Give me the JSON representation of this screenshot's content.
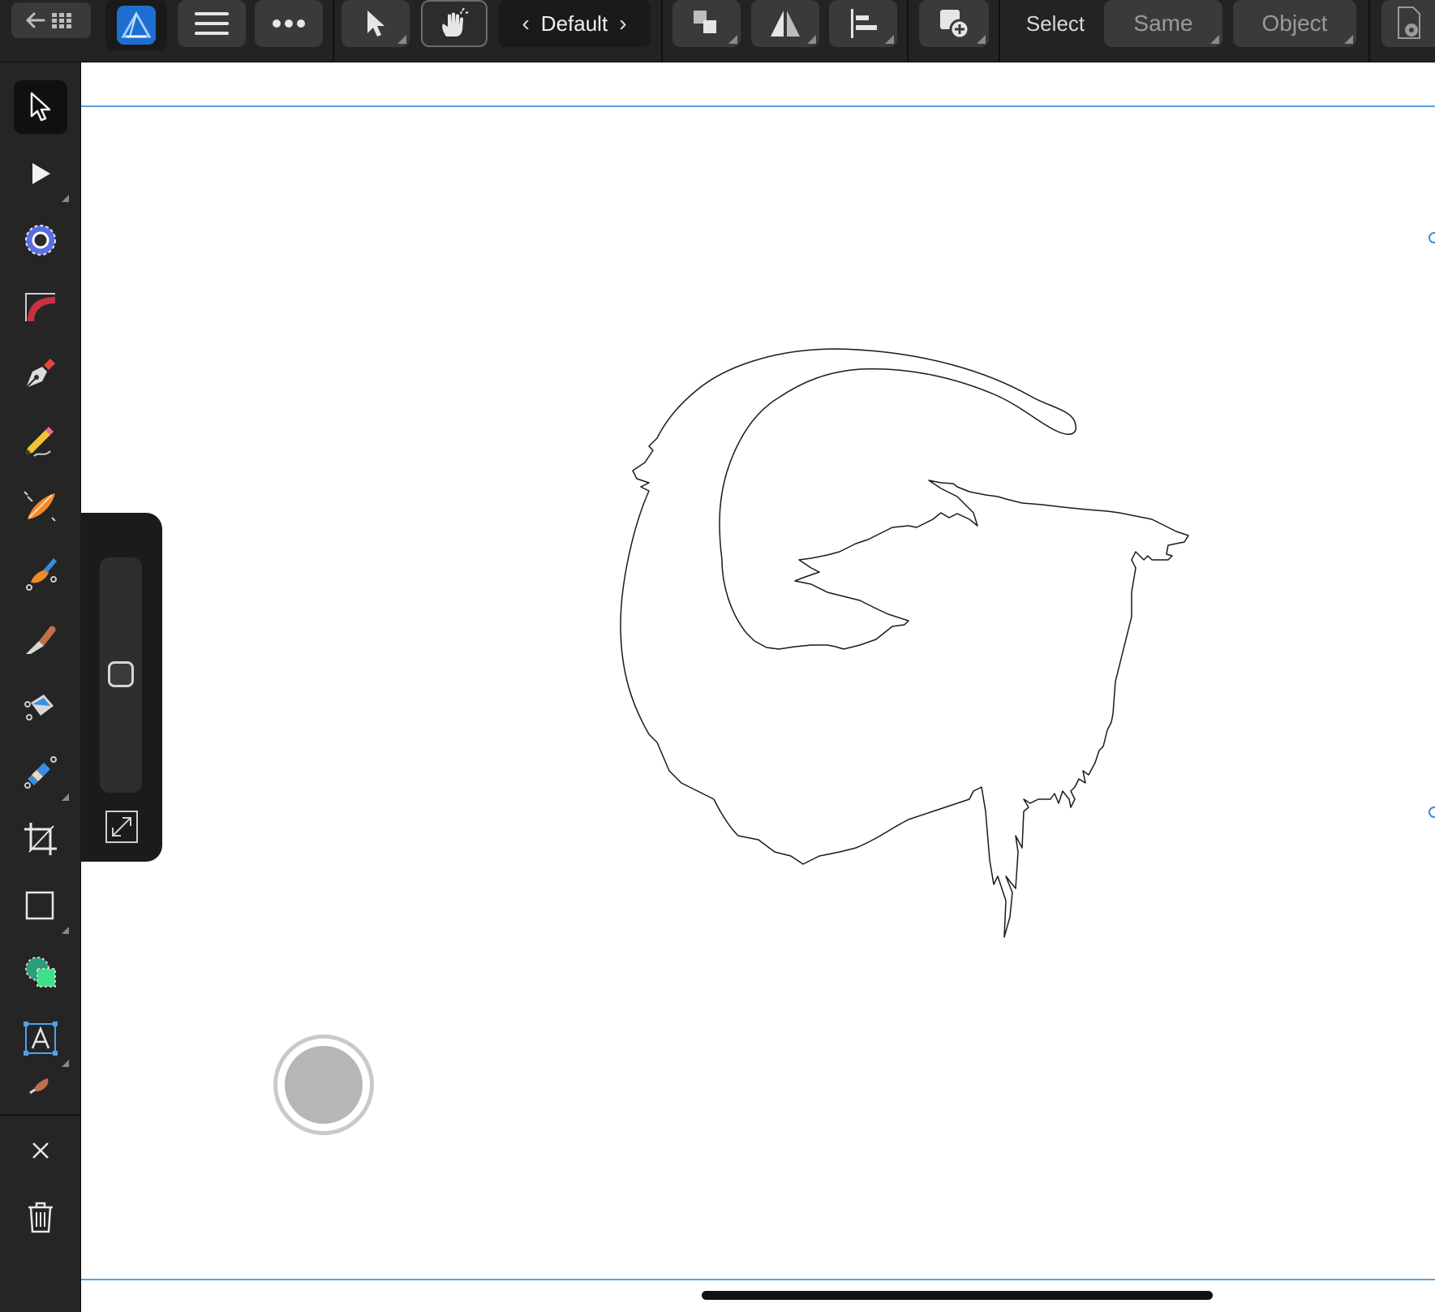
{
  "app": {
    "name": "Affinity Designer",
    "accent": "#2f8fe8"
  },
  "toolbar": {
    "persona_label": "Default",
    "select_label": "Select",
    "same_label": "Same",
    "object_label": "Object"
  },
  "tools": [
    "move-tool",
    "node-tool",
    "corner-tool",
    "contour-tool",
    "pen-tool",
    "pencil-tool",
    "vector-brush-tool",
    "vector-crop-tool",
    "knife-tool",
    "fill-tool",
    "transparency-tool",
    "crop-tool",
    "rectangle-tool",
    "shape-builder-tool",
    "frame-text-tool",
    "paint-brush-tool"
  ],
  "colors": {
    "toolbar_bg": "#232323",
    "rail_bg": "#252525",
    "guide": "#3d8fd6",
    "canvas": "#ffffff",
    "pen_red": "#e1473b",
    "move_blue": "#5b6fe0"
  }
}
